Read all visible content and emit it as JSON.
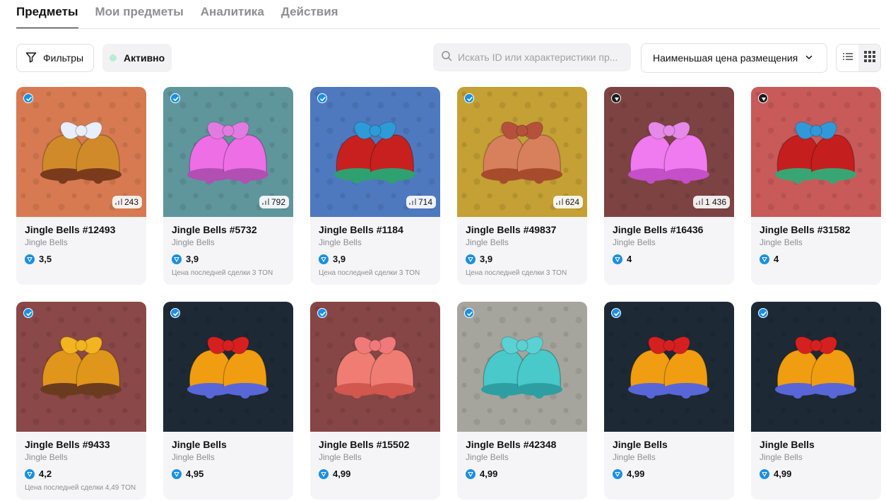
{
  "tabs": [
    {
      "label": "Предметы",
      "active": true
    },
    {
      "label": "Мои предметы",
      "active": false
    },
    {
      "label": "Аналитика",
      "active": false
    },
    {
      "label": "Действия",
      "active": false
    }
  ],
  "toolbar": {
    "filters_label": "Фильтры",
    "active_label": "Активно",
    "search_placeholder": "Искать ID или характеристики пр...",
    "sort_label": "Наименьшая цена размещения",
    "view_mode": "grid"
  },
  "colors": {
    "ton_blue": "#1b8fe6",
    "active_dot": "#b9ecd3"
  },
  "items": [
    {
      "title": "Jingle Bells #12493",
      "subtitle": "Jingle Bells",
      "price": "3,5",
      "count": "243",
      "note": "",
      "badge": "blue-check-icon",
      "bg": "#d77a52",
      "bow": "#e8eefa",
      "bell": "#d08a2a",
      "bell2": "#7a3a1c"
    },
    {
      "title": "Jingle Bells #5732",
      "subtitle": "Jingle Bells",
      "price": "3,9",
      "count": "792",
      "note": "Цена последней сделки 3 TON",
      "badge": "blue-check-icon",
      "bg": "#5f969b",
      "bow": "#e27be0",
      "bell": "#ee6ee6",
      "bell2": "#b14fb3"
    },
    {
      "title": "Jingle Bells #1184",
      "subtitle": "Jingle Bells",
      "price": "3,9",
      "count": "714",
      "note": "Цена последней сделки 3 TON",
      "badge": "blue-check-icon",
      "bg": "#4f79bf",
      "bow": "#2f9ad8",
      "bell": "#c8201f",
      "bell2": "#2fa070"
    },
    {
      "title": "Jingle Bells #49837",
      "subtitle": "Jingle Bells",
      "price": "3,9",
      "count": "624",
      "note": "Цена последней сделки 3 TON",
      "badge": "blue-check-icon",
      "bg": "#c4a035",
      "bow": "#b5513a",
      "bell": "#d8805b",
      "bell2": "#a64c2c"
    },
    {
      "title": "Jingle Bells #16436",
      "subtitle": "Jingle Bells",
      "price": "4",
      "count": "1 436",
      "note": "",
      "badge": "dark-triangle-icon",
      "bg": "#7d4343",
      "bow": "#e58ae8",
      "bell": "#f07af0",
      "bell2": "#c44fc8"
    },
    {
      "title": "Jingle Bells #31582",
      "subtitle": "Jingle Bells",
      "price": "4",
      "count": "",
      "note": "",
      "badge": "dark-triangle-icon",
      "bg": "#c95a5a",
      "bow": "#3298d8",
      "bell": "#c51e1e",
      "bell2": "#3aa574"
    },
    {
      "title": "Jingle Bells #9433",
      "subtitle": "Jingle Bells",
      "price": "4,2",
      "count": "",
      "note": "Цена последней сделки 4,49 TON",
      "badge": "blue-check-icon",
      "bg": "#8a4848",
      "bow": "#f2b421",
      "bell": "#e0961b",
      "bell2": "#6b3b20"
    },
    {
      "title": "Jingle Bells",
      "subtitle": "Jingle Bells",
      "price": "4,95",
      "count": "",
      "note": "",
      "badge": "blue-check-icon",
      "bg": "#1d2a35",
      "bow": "#d62020",
      "bell": "#f19d12",
      "bell2": "#5866d8"
    },
    {
      "title": "Jingle Bells #15502",
      "subtitle": "Jingle Bells",
      "price": "4,99",
      "count": "",
      "note": "",
      "badge": "blue-check-icon",
      "bg": "#874646",
      "bow": "#f07a7a",
      "bell": "#ef7d73",
      "bell2": "#d2574f"
    },
    {
      "title": "Jingle Bells #42348",
      "subtitle": "Jingle Bells",
      "price": "4,99",
      "count": "",
      "note": "",
      "badge": "blue-check-icon",
      "bg": "#a6a59d",
      "bow": "#5bd1d4",
      "bell": "#49c9c9",
      "bell2": "#2d9fa3"
    },
    {
      "title": "Jingle Bells",
      "subtitle": "Jingle Bells",
      "price": "4,99",
      "count": "",
      "note": "",
      "badge": "blue-check-icon",
      "bg": "#1d2a35",
      "bow": "#d62020",
      "bell": "#f19d12",
      "bell2": "#5866d8"
    },
    {
      "title": "Jingle Bells",
      "subtitle": "Jingle Bells",
      "price": "4,99",
      "count": "",
      "note": "",
      "badge": "blue-check-icon",
      "bg": "#1d2a35",
      "bow": "#d62020",
      "bell": "#f19d12",
      "bell2": "#5866d8"
    }
  ]
}
